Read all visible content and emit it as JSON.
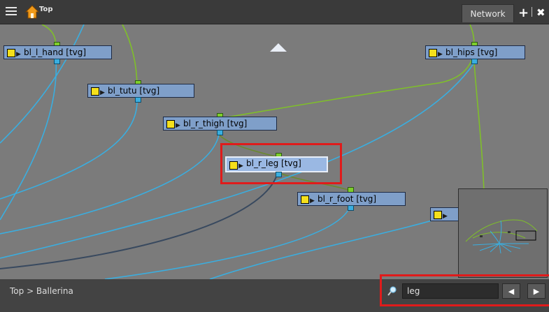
{
  "titlebar": {
    "title": "Top",
    "tab_label": "Network",
    "add_label": "+",
    "close_label": "✖"
  },
  "nodes": [
    {
      "label": "bl_l_hand  [tvg]"
    },
    {
      "label": "bl_tutu  [tvg]"
    },
    {
      "label": "bl_r_thigh  [tvg]"
    },
    {
      "label": "bl_r_leg  [tvg]"
    },
    {
      "label": "bl_r_foot  [tvg]"
    },
    {
      "label": "bl_hips  [tvg]"
    },
    {
      "label": ""
    }
  ],
  "statusbar": {
    "breadcrumb": "Top  >  Ballerina",
    "search_value": "leg",
    "prev_label": "◀",
    "next_label": "▶"
  },
  "colors": {
    "node_fill": "#7f9fc9",
    "wire_green": "#7fbf2a",
    "wire_blue": "#3aaee0",
    "highlight": "#e01b1b"
  }
}
